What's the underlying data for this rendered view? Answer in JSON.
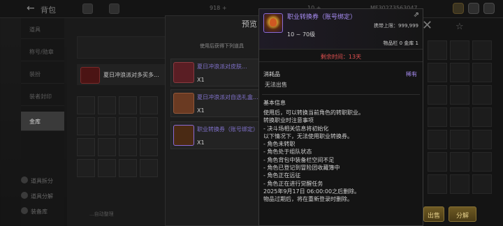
{
  "topbar": {
    "back_arrow": "←",
    "title": "背包",
    "currency_left": "918 +",
    "currency_mid": "10 +",
    "currency_right": "MF30273563047"
  },
  "sidebar": {
    "items": [
      "道具",
      "称号/勋章",
      "装扮",
      "装者封印",
      "金库"
    ],
    "bottom_items": [
      "道具拆分",
      "道具分解",
      "装备库"
    ]
  },
  "inventory": {
    "event_item_text": "夏日冲浪派对多买多...",
    "bottom_hint": "...自动整理"
  },
  "preview": {
    "title": "预览",
    "subtitle": "使用后获得下列道具",
    "rewards": [
      {
        "name": "夏日冲浪派对皮肤...",
        "count": "X1"
      },
      {
        "name": "夏日冲浪派对自选礼盒...",
        "count": "X1"
      },
      {
        "name": "职业转换券（账号绑定）",
        "count": "X1"
      }
    ]
  },
  "right_panel": {
    "close_symbol": "✕",
    "star_symbol": "☆",
    "button_left": "出售",
    "button_right": "分解"
  },
  "tooltip": {
    "item_name": "职业转换券（账号绑定）",
    "share_symbol": "⇗",
    "carry_limit": "携带上限：999,999",
    "level_range": "10 ~ 70级",
    "storage": "物品栏 0  金库 1",
    "remaining_time": "剩余时间：13天",
    "category": "消耗品",
    "rarity": "稀有",
    "trade": "无法出售",
    "basic_info_title": "基本信息",
    "description_lines": [
      "使用后，可以转换当前角色的转职职业。",
      "转换职业时注意事项",
      "- 决斗场相关信息将初始化",
      "以下情况下，无法使用职业转换券。",
      "- 角色未转职",
      "- 角色处于组队状态",
      "- 角色背包中装备栏空间不足",
      "- 角色已登记到冒险团收藏簿中",
      "- 角色正在远征",
      "- 角色正在进行觉醒任务",
      "2025年9月17日 06:00:00之后删除。",
      "物品过期后，将在重新登录时删除。"
    ]
  },
  "colors": {
    "rare_purple": "#a78cf2",
    "warning_red": "#e35151",
    "gold_button": "#6e5a24"
  }
}
